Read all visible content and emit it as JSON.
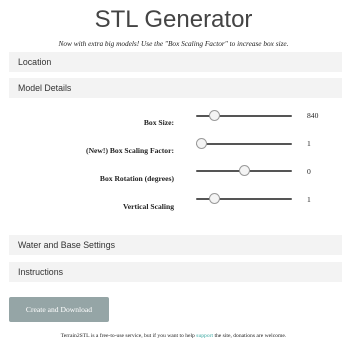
{
  "header": {
    "title": "STL Generator",
    "subtitle": "Now with extra big models! Use the \"Box Scaling Factor\" to increase box size."
  },
  "panels": {
    "location": "Location",
    "model_details": "Model Details",
    "water_base": "Water and Base Settings",
    "instructions": "Instructions"
  },
  "controls": [
    {
      "label": "Box Size:",
      "value": "840",
      "level": 0.15
    },
    {
      "label": "(New!) Box Scaling Factor:",
      "value": "1",
      "level": 0.0
    },
    {
      "label": "Box Rotation (degrees)",
      "value": "0",
      "level": 0.5
    },
    {
      "label": "Vertical Scaling",
      "value": "1",
      "level": 0.15
    }
  ],
  "actions": {
    "create_download": "Create and Download"
  },
  "footer": {
    "before": "Terrain2STL is a free-to-use service, but if you want to help ",
    "link": "support",
    "after": " the site, donations are welcome."
  }
}
